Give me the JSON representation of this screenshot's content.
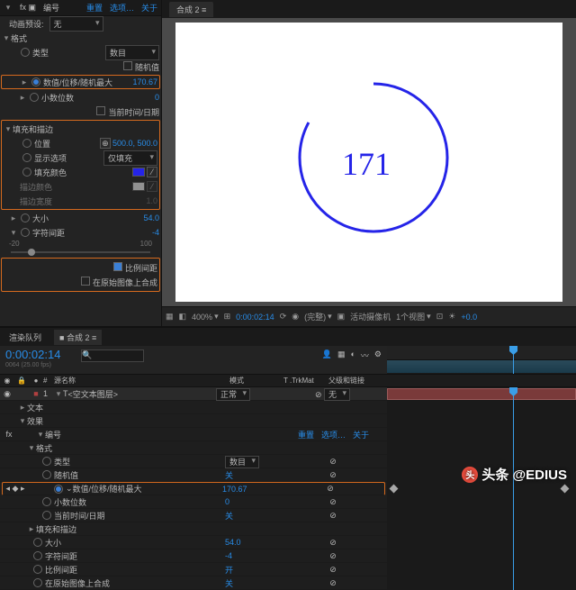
{
  "fx": {
    "tab_fx": "fx",
    "tab_numbers": "编号",
    "menu_reset": "重置",
    "menu_select": "选项…",
    "menu_about": "关于",
    "preset_label": "动画预设:",
    "preset_value": "无",
    "section_format": "格式",
    "row_type_label": "类型",
    "row_type_value": "数目",
    "row_random_label": "随机值",
    "row_value_label": "数值/位移/随机最大",
    "row_value_value": "170.67",
    "row_decimal_label": "小数位数",
    "row_decimal_value": "0",
    "row_date_label": "当前时间/日期",
    "section_fillstroke": "填充和描边",
    "row_pos_label": "位置",
    "row_pos_value": "500.0, 500.0",
    "row_display_label": "显示选项",
    "row_display_value": "仅填充",
    "row_fillcolor_label": "填充颜色",
    "row_strokecolor_label": "描边颜色",
    "row_strokewidth_label": "描边宽度",
    "row_strokewidth_value": "1.0",
    "row_size_label": "大小",
    "row_size_value": "54.0",
    "row_tracking_label": "字符间距",
    "row_tracking_value": "-4",
    "slider_min": "-20",
    "slider_mid": "0",
    "slider_max": "100",
    "row_proportional_label": "比例间距",
    "row_composite_label": "在原始图像上合成",
    "fill_color": "#2524e8",
    "stroke_color": "#ffffff"
  },
  "preview": {
    "tab": "合成 2",
    "number": "171",
    "zoom": "400%",
    "timecode": "0:00:02:14",
    "res": "(完整)",
    "camera": "活动摄像机",
    "view": "1个视图",
    "extra": "+0.0"
  },
  "timeline": {
    "tab_queue": "渲染队列",
    "tab_comp": "合成 2",
    "current_time": "0:00:02:14",
    "cols_name": "源名称",
    "cols_mode": "模式",
    "cols_trk": "T .TrkMat",
    "cols_parent": "父级和链接",
    "layer_index": "1",
    "layer_name": "<空文本图层>",
    "layer_mode": "正常",
    "layer_trk": "",
    "layer_parent": "无",
    "r_text": "文本",
    "r_effects": "效果",
    "r_numbers": "编号",
    "r_menu_reset": "重置",
    "r_menu_select": "选项…",
    "r_menu_about": "关于",
    "r_format": "格式",
    "r_type": "类型",
    "r_type_val": "数目",
    "r_random": "随机值",
    "r_random_val": "关",
    "r_value": "数值/位移/随机最大",
    "r_value_val": "170.67",
    "r_decimal": "小数位数",
    "r_decimal_val": "0",
    "r_date": "当前时间/日期",
    "r_date_val": "关",
    "r_fillstroke": "填充和描边",
    "r_size": "大小",
    "r_size_val": "54.0",
    "r_tracking": "字符间距",
    "r_tracking_val": "-4",
    "r_proportional": "比例间距",
    "r_proportional_val": "开",
    "r_composite": "在原始图像上合成",
    "r_composite_val": "关"
  },
  "watermark": "头条 @EDIUS"
}
